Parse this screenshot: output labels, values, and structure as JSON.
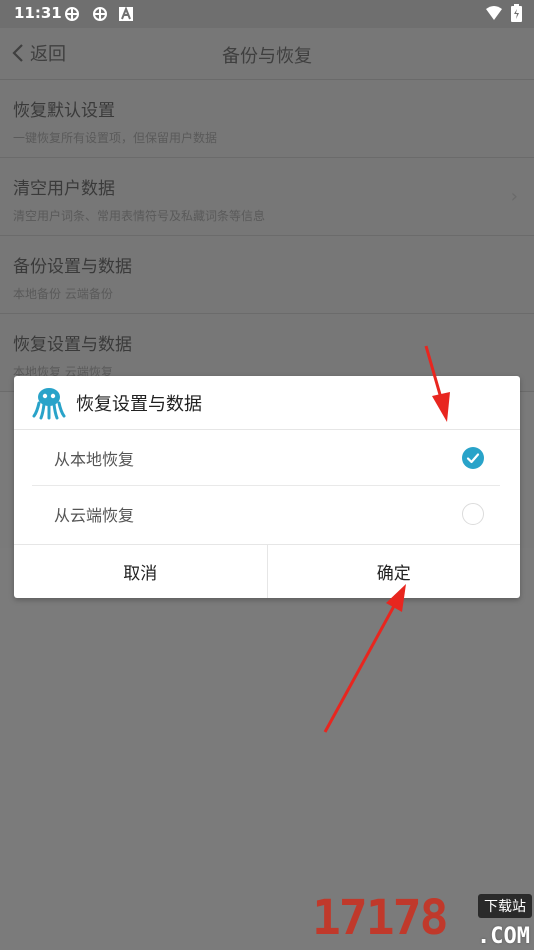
{
  "status_bar": {
    "time": "11:31"
  },
  "header": {
    "back_label": "返回",
    "title": "备份与恢复"
  },
  "settings": [
    {
      "title": "恢复默认设置",
      "subtitle": "一键恢复所有设置项，但保留用户数据",
      "chevron": false
    },
    {
      "title": "清空用户数据",
      "subtitle": "清空用户词条、常用表情符号及私藏词条等信息",
      "chevron": true
    },
    {
      "title": "备份设置与数据",
      "subtitle": "本地备份 云端备份",
      "chevron": false
    },
    {
      "title": "恢复设置与数据",
      "subtitle": "本地恢复 云端恢复",
      "chevron": false
    }
  ],
  "dialog": {
    "title": "恢复设置与数据",
    "options": [
      {
        "label": "从本地恢复",
        "selected": true
      },
      {
        "label": "从云端恢复",
        "selected": false
      }
    ],
    "cancel_label": "取消",
    "confirm_label": "确定"
  },
  "watermark": {
    "digits": "17178",
    "tag": "下载站",
    "domain": ".COM"
  },
  "colors": {
    "accent": "#29a3c9",
    "annotation": "#e8261f"
  }
}
